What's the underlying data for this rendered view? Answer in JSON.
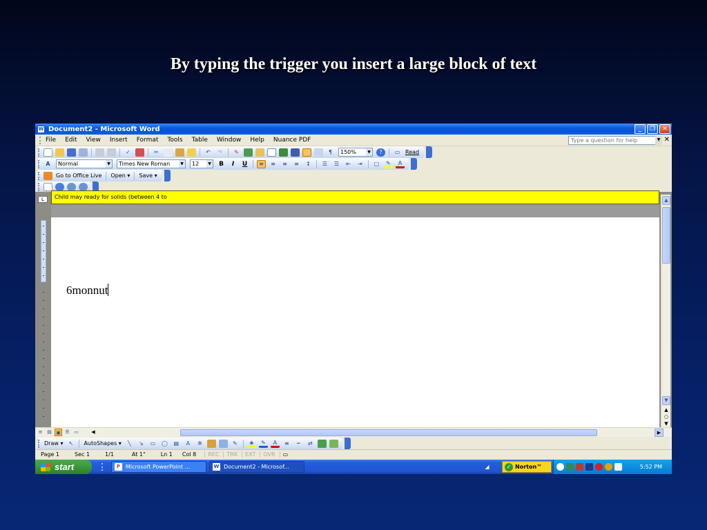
{
  "slide": {
    "title": "By typing the trigger you insert a large block of text"
  },
  "window": {
    "title": "Document2 - Microsoft Word",
    "controls": {
      "minimize": "_",
      "restore": "❐",
      "close": "✕"
    }
  },
  "menu": {
    "items": [
      "File",
      "Edit",
      "View",
      "Insert",
      "Format",
      "Tools",
      "Table",
      "Window",
      "Help",
      "Nuance PDF"
    ],
    "help_placeholder": "Type a question for help",
    "close": "✕"
  },
  "standard_toolbar": {
    "zoom": "150%",
    "read_label": "Read"
  },
  "formatting_toolbar": {
    "style": "Normal",
    "font": "Times New Roman",
    "size": "12",
    "bold": "B",
    "italic": "I",
    "underline": "U"
  },
  "office_live_toolbar": {
    "go_label": "Go to Office Live",
    "open_label": "Open ▾",
    "save_label": "Save ▾"
  },
  "autotext_tip": "Child may ready for solids (between 4 to",
  "document": {
    "text": "6monnut"
  },
  "status": {
    "page": "Page 1",
    "sec": "Sec 1",
    "pages": "1/1",
    "at": "At 1\"",
    "ln": "Ln 1",
    "col": "Col 8",
    "modes": [
      "REC",
      "TRK",
      "EXT",
      "OVR"
    ]
  },
  "drawing_toolbar": {
    "draw_label": "Draw ▾",
    "autoshapes_label": "AutoShapes ▾"
  },
  "taskbar": {
    "start_label": "start",
    "items": [
      "Microsoft PowerPoint ...",
      "Document2 - Microsof..."
    ],
    "norton_label": "Norton™",
    "clock": "5:52 PM"
  },
  "colors": {
    "slide_background": "#062066",
    "autotext_highlight": "#ffff00",
    "titlebar": "#0a5ae0",
    "taskbar": "#245edb",
    "start_button": "#3a9a3a"
  }
}
